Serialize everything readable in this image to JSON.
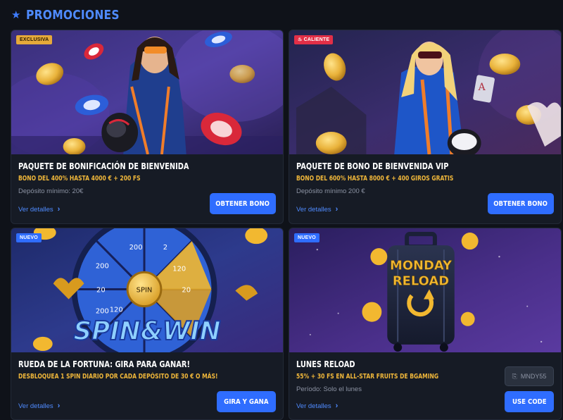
{
  "header": {
    "icon": "star-icon",
    "title": "PROMOCIONES"
  },
  "colors": {
    "accent": "#2f6dff",
    "gold": "#f0b73a",
    "background": "#0f1219",
    "card": "#161b25"
  },
  "promotions": [
    {
      "badge": "EXCLUSIVA",
      "title": "PAQUETE DE BONIFICACIÓN DE BIENVENIDA",
      "offer": "BONO DEL 400% HASTA 4000 € + 200 FS",
      "meta": "Depósito mínimo: 20€",
      "details": "Ver detalles",
      "cta": "OBTENER BONO"
    },
    {
      "badge": "CALIENTE",
      "title": "PAQUETE DE BONO DE BIENVENIDA VIP",
      "offer": "BONO DEL 600% HASTA 8000 € + 400 GIROS GRATIS",
      "meta": "Depósito mínimo 200 €",
      "details": "Ver detalles",
      "cta": "OBTENER BONO"
    },
    {
      "badge": "NUEVO",
      "title": "RUEDA DE LA FORTUNA: GIRA PARA GANAR!",
      "offer": "DESBLOQUEA 1 SPIN DIARIO POR CADA DEPÓSITO DE 30 € O MÁS!",
      "details": "Ver detalles",
      "cta": "GIRA Y GANA",
      "banner": {
        "wheel_center": "SPIN",
        "wheel_values": [
          "200",
          "2",
          "120",
          "20",
          "200",
          "120",
          "20",
          "200"
        ],
        "logo_text": "SPIN&WIN"
      }
    },
    {
      "badge": "NUEVO",
      "title": "LUNES RELOAD",
      "offer": "55% + 30 FS EN ALL-STAR FRUITS DE BGAMING",
      "meta": "Período: Solo el lunes",
      "details": "Ver detalles",
      "cta": "USE CODE",
      "code": "MNDY55",
      "banner": {
        "line1": "MONDAY",
        "line2": "RELOAD"
      }
    }
  ]
}
